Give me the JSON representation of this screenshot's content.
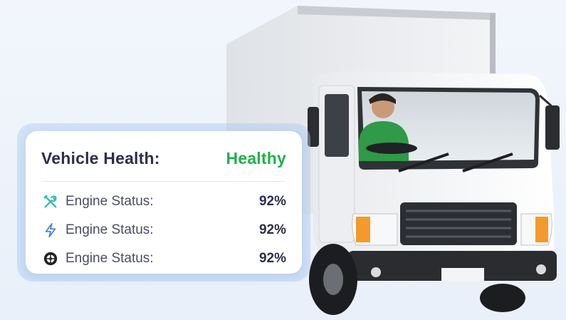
{
  "health_card": {
    "title": "Vehicle Health:",
    "status": "Healthy",
    "status_color": "#22b14c",
    "metrics": [
      {
        "icon": "tools-icon",
        "label": "Engine Status:",
        "value": "92%",
        "icon_color": "#2bbfa4"
      },
      {
        "icon": "lightning-icon",
        "label": "Engine Status:",
        "value": "92%",
        "icon_color": "#3b7de0"
      },
      {
        "icon": "tire-icon",
        "label": "Engine Status:",
        "value": "92%",
        "icon_color": "#222222"
      }
    ]
  }
}
